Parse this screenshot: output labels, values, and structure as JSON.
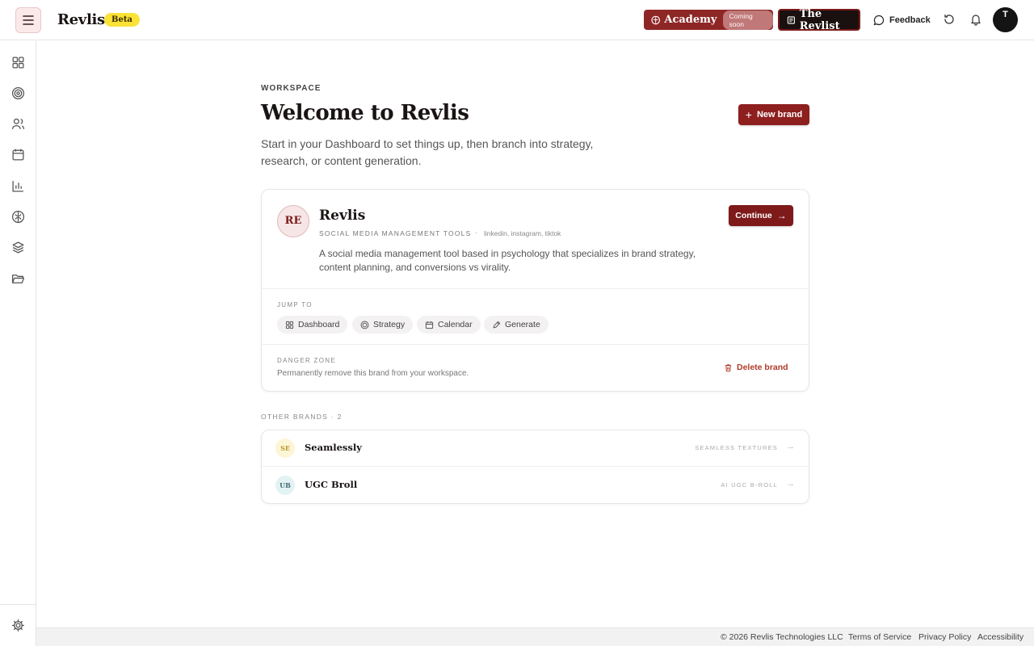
{
  "header": {
    "logo": "Revlis",
    "beta_badge": "Beta",
    "academy_label": "Academy",
    "academy_badge": "Coming soon",
    "revlist_label": "The Revlist",
    "feedback_label": "Feedback",
    "avatar_initial": "T"
  },
  "sidebar": {
    "items": [
      "grid-icon",
      "target-icon",
      "users-icon",
      "calendar-icon",
      "bar-chart-icon",
      "brain-icon",
      "layers-icon",
      "folder-icon"
    ],
    "bottom": "gear-icon"
  },
  "main": {
    "eyebrow": "WORKSPACE",
    "title": "Welcome to Revlis",
    "subtitle": "Start in your Dashboard to set things up, then branch into strategy, research, or content generation.",
    "new_brand_label": "New brand"
  },
  "active_brand": {
    "initials": "RE",
    "name": "Revlis",
    "category": "SOCIAL MEDIA MANAGEMENT TOOLS",
    "separator": "·",
    "platforms": "linkedin, instagram, tiktok",
    "description": "A social media management tool based in psychology that specializes in brand strategy, content planning, and conversions vs virality.",
    "continue_label": "Continue",
    "jump_to_label": "JUMP TO",
    "jump_links": [
      "Dashboard",
      "Strategy",
      "Calendar",
      "Generate"
    ],
    "danger_label": "DANGER ZONE",
    "danger_text": "Permanently remove this brand from your workspace.",
    "delete_label": "Delete brand"
  },
  "other_brands": {
    "label": "OTHER BRANDS · 2",
    "items": [
      {
        "initials": "SE",
        "name": "Seamlessly",
        "tag": "SEAMLESS TEXTURES",
        "avatar_bg": "#fdf6d6",
        "avatar_fg": "#b79a2e"
      },
      {
        "initials": "UB",
        "name": "UGC Broll",
        "tag": "AI UGC B-ROLL",
        "avatar_bg": "#e3f2f3",
        "avatar_fg": "#3f6b70"
      }
    ]
  },
  "footer": {
    "copyright": "© 2026 Revlis Technologies LLC",
    "terms": "Terms of Service",
    "privacy": "Privacy Policy",
    "accessibility": "Accessibility"
  },
  "colors": {
    "brand": "#8e1f1f",
    "beta": "#fbe237",
    "danger": "#b13a2a"
  }
}
